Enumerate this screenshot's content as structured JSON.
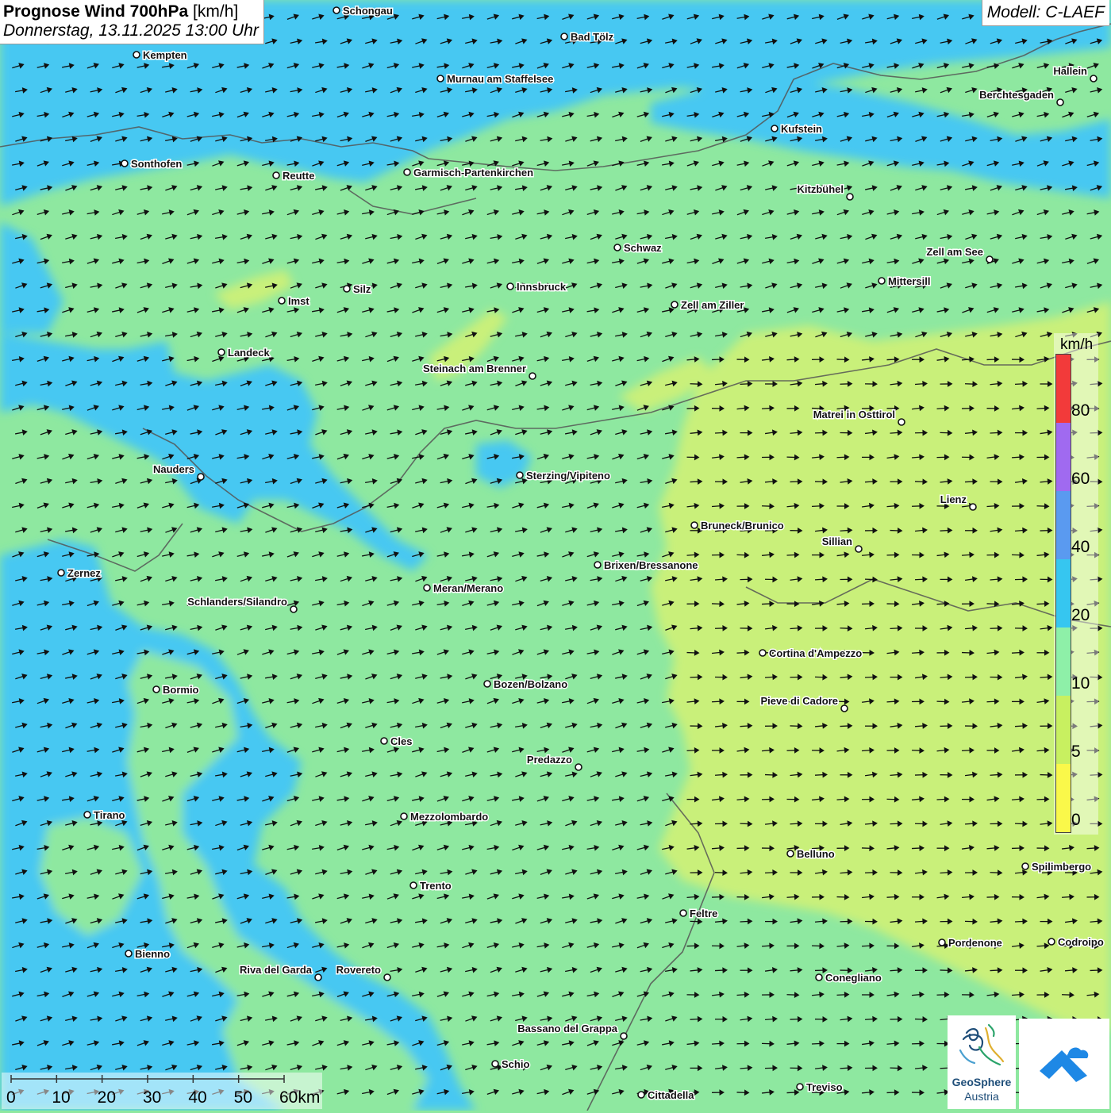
{
  "header": {
    "title_bold": "Prognose Wind 700hPa",
    "title_unit": "[km/h]",
    "datetime": "Donnerstag, 13.11.2025 13:00 Uhr"
  },
  "model_label": "Modell: C-LAEF",
  "legend": {
    "unit": "km/h",
    "ticks": [
      "80",
      "60",
      "40",
      "20",
      "10",
      "5",
      "0"
    ],
    "colors": [
      "#f23a3a",
      "#a06af0",
      "#5a9af0",
      "#36c6f0",
      "#8ef0a8",
      "#c8f060",
      "#faf84a"
    ]
  },
  "scale_bar": {
    "labels": [
      "0",
      "10",
      "20",
      "30",
      "40",
      "50",
      "60km"
    ]
  },
  "logo": {
    "name": "GeoSphere",
    "sub": "Austria",
    "icon": "geosphere-logo-icon",
    "icon2": "mountain-cloud-logo-icon"
  },
  "palette": {
    "blue": "#46c8f2",
    "green": "#8ee8a0",
    "yellow": "#c9f07a",
    "arrow": "#111111"
  },
  "cities": [
    {
      "name": "Schongau"
    },
    {
      "name": "Bad Tölz"
    },
    {
      "name": "Kempten"
    },
    {
      "name": "Murnau am Staffelsee"
    },
    {
      "name": "Hallein"
    },
    {
      "name": "Berchtesgaden"
    },
    {
      "name": "Kufstein"
    },
    {
      "name": "Sonthofen"
    },
    {
      "name": "Reutte"
    },
    {
      "name": "Garmisch-Partenkirchen"
    },
    {
      "name": "Kitzbühel"
    },
    {
      "name": "Schwaz"
    },
    {
      "name": "Zell am See"
    },
    {
      "name": "Mittersill"
    },
    {
      "name": "Innsbruck"
    },
    {
      "name": "Silz"
    },
    {
      "name": "Imst"
    },
    {
      "name": "Zell am Ziller"
    },
    {
      "name": "Landeck"
    },
    {
      "name": "Steinach am Brenner"
    },
    {
      "name": "Matrei in Osttirol"
    },
    {
      "name": "Nauders"
    },
    {
      "name": "Sterzing/Vipiteno"
    },
    {
      "name": "Lienz"
    },
    {
      "name": "Bruneck/Brunico"
    },
    {
      "name": "Sillian"
    },
    {
      "name": "Brixen/Bressanone"
    },
    {
      "name": "Zernez"
    },
    {
      "name": "Meran/Merano"
    },
    {
      "name": "Schlanders/Silandro"
    },
    {
      "name": "Cortina d'Ampezzo"
    },
    {
      "name": "Bozen/Bolzano"
    },
    {
      "name": "Bormio"
    },
    {
      "name": "Pieve di Cadore"
    },
    {
      "name": "Cles"
    },
    {
      "name": "Predazzo"
    },
    {
      "name": "Tirano"
    },
    {
      "name": "Mezzolombardo"
    },
    {
      "name": "Belluno"
    },
    {
      "name": "Spilimbergo"
    },
    {
      "name": "Trento"
    },
    {
      "name": "Feltre"
    },
    {
      "name": "Pordenone"
    },
    {
      "name": "Codroipo"
    },
    {
      "name": "Bienno"
    },
    {
      "name": "Riva del Garda"
    },
    {
      "name": "Rovereto"
    },
    {
      "name": "Conegliano"
    },
    {
      "name": "Bassano del Grappa"
    },
    {
      "name": "Schio"
    },
    {
      "name": "Treviso"
    },
    {
      "name": "Cittadella"
    }
  ]
}
